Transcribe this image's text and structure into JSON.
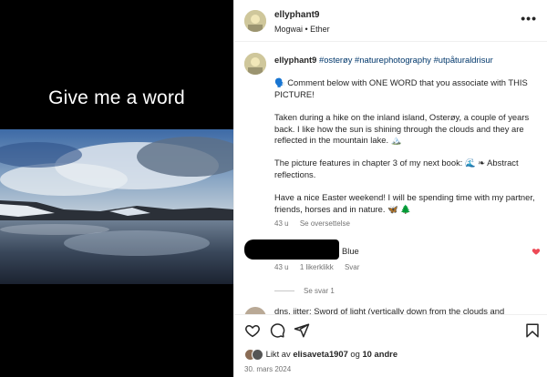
{
  "media": {
    "caption": "Give me a word"
  },
  "header": {
    "username": "ellyphant9",
    "subtitle": "Mogwai • Ether",
    "more_icon": "more-horizontal-icon"
  },
  "post": {
    "username": "ellyphant9",
    "hashtags": "#osterøy #naturephotography #utpåturaldrisur",
    "paragraph1": "🗣️ Comment below with ONE WORD that you associate with THIS PICTURE!",
    "paragraph2": "Taken during a hike on the inland island, Osterøy, a couple of years back. I like how the sun is shining through the clouds and they are reflected in the mountain lake. 🏔️",
    "paragraph3": "The picture features in chapter 3 of my next book: 🌊 ❧ Abstract reflections.",
    "paragraph4": "Have a nice Easter weekend! I will be spending time with my partner, friends, horses and in nature. 🦋 🌲",
    "age": "43 u",
    "translate": "Se oversettelse"
  },
  "comments": [
    {
      "text": "Blue",
      "age": "43 u",
      "likes": "1 likerklikk",
      "reply": "Svar",
      "liked": true
    }
  ],
  "replies_link": "Se svar 1",
  "comment2_text": "dns, jitter: Sword of light (vertically down from the clouds and",
  "actions": {
    "icons": [
      "heart-icon",
      "comment-icon",
      "share-icon",
      "bookmark-icon"
    ],
    "liked_by_prefix": "Likt av",
    "liked_by_user": "elisaveta1907",
    "liked_by_mid": "og",
    "liked_by_others": "10 andre",
    "date": "30. mars 2024"
  },
  "colors": {
    "heart_red": "#ed4956",
    "hashtag_blue": "#00376b",
    "muted": "#737373"
  }
}
